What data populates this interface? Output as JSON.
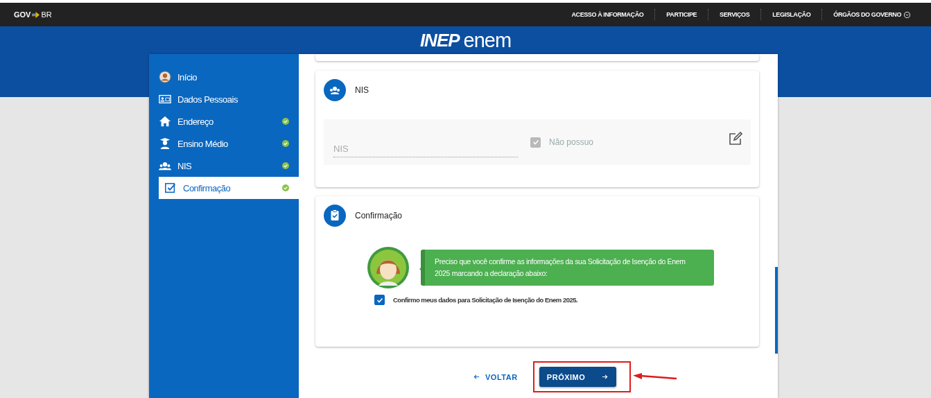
{
  "gov_bar": {
    "logo_left": "GOV",
    "logo_right": "BR",
    "links": [
      {
        "label": "ACESSO À INFORMAÇÃO",
        "dropdown": false
      },
      {
        "label": "PARTICIPE",
        "dropdown": false
      },
      {
        "label": "SERVIÇOS",
        "dropdown": false
      },
      {
        "label": "LEGISLAÇÃO",
        "dropdown": false
      },
      {
        "label": "ÓRGÃOS DO GOVERNO",
        "dropdown": true
      }
    ]
  },
  "header": {
    "logo_left": "INEP",
    "logo_right": "enem"
  },
  "sidebar": {
    "items": [
      {
        "label": "Início",
        "completed": false,
        "selected": false
      },
      {
        "label": "Dados Pessoais",
        "completed": false,
        "selected": false
      },
      {
        "label": "Endereço",
        "completed": true,
        "selected": false
      },
      {
        "label": "Ensino Médio",
        "completed": true,
        "selected": false
      },
      {
        "label": "NIS",
        "completed": true,
        "selected": false
      },
      {
        "label": "Confirmação",
        "completed": true,
        "selected": true
      }
    ]
  },
  "nis_section": {
    "title": "NIS",
    "field": {
      "placeholder": "NIS"
    },
    "no_nis": {
      "label": "Não possuo",
      "checked": true,
      "disabled": true
    }
  },
  "confirm_section": {
    "title": "Confirmação",
    "message": "Preciso que você confirme as informações da sua Solicitação de Isenção do Enem 2025 marcando a declaração abaixo:",
    "declaration": {
      "label": "Confirmo meus dados para Solicitação de Isenção do Enem 2025.",
      "checked": true
    }
  },
  "actions": {
    "back": "VOLTAR",
    "next": "PRÓXIMO"
  }
}
